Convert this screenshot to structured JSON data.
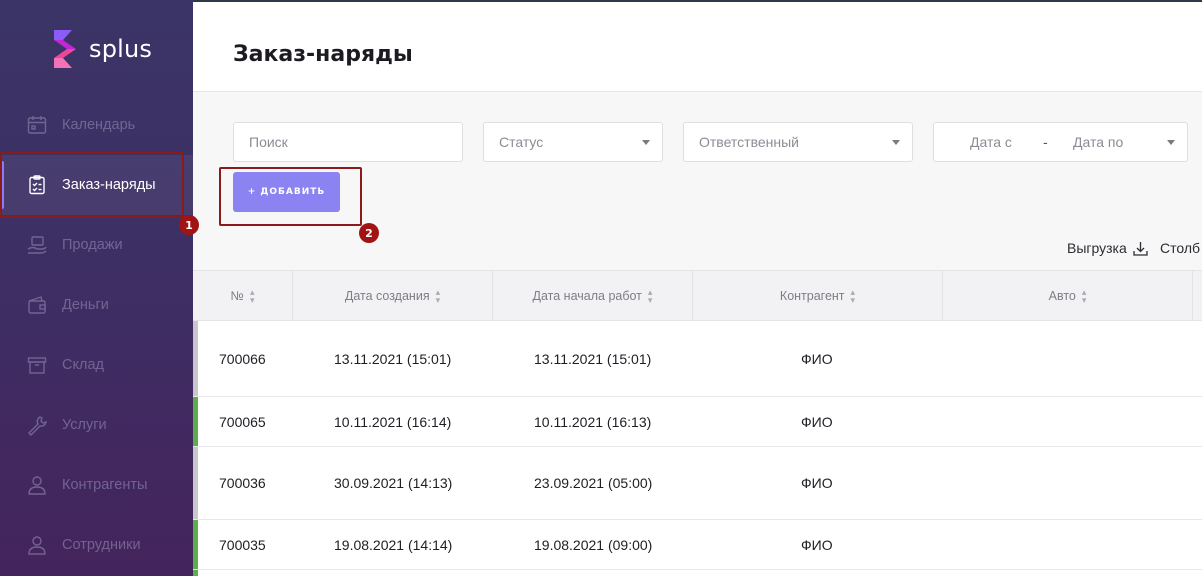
{
  "app": {
    "logo_text": "splus",
    "brand_color": "#8b83f2"
  },
  "sidebar": {
    "items": [
      {
        "label": "Календарь",
        "icon": "calendar-icon"
      },
      {
        "label": "Заказ-наряды",
        "icon": "clipboard-icon",
        "active": true
      },
      {
        "label": "Продажи",
        "icon": "hand-coin-icon"
      },
      {
        "label": "Деньги",
        "icon": "wallet-icon"
      },
      {
        "label": "Склад",
        "icon": "box-icon"
      },
      {
        "label": "Услуги",
        "icon": "wrench-icon"
      },
      {
        "label": "Контрагенты",
        "icon": "person-icon"
      },
      {
        "label": "Сотрудники",
        "icon": "person-icon"
      }
    ]
  },
  "annotations": {
    "badge1": "1",
    "badge2": "2"
  },
  "header": {
    "title": "Заказ-наряды"
  },
  "filters": {
    "search_placeholder": "Поиск",
    "status_placeholder": "Статус",
    "responsible_placeholder": "Ответственный",
    "date_from": "Дата с",
    "date_sep": "-",
    "date_to": "Дата по"
  },
  "actions": {
    "add_label": "+ ДОБАВИТЬ",
    "export_label": "Выгрузка",
    "columns_label": "Столб"
  },
  "table": {
    "headers": [
      "№",
      "Дата создания",
      "Дата начала работ",
      "Контрагент",
      "Авто"
    ],
    "rows": [
      {
        "number": "700066",
        "created": "13.11.2021 (15:01)",
        "start": "13.11.2021 (15:01)",
        "contractor": "ФИО",
        "marker": "#c8c8cc"
      },
      {
        "number": "700065",
        "created": "10.11.2021 (16:14)",
        "start": "10.11.2021 (16:13)",
        "contractor": "ФИО",
        "marker": "#5cae4a"
      },
      {
        "number": "700036",
        "created": "30.09.2021 (14:13)",
        "start": "23.09.2021 (05:00)",
        "contractor": "ФИО",
        "marker": "#c8c8cc"
      },
      {
        "number": "700035",
        "created": "19.08.2021 (14:14)",
        "start": "19.08.2021 (09:00)",
        "contractor": "ФИО",
        "marker": "#5cae4a"
      }
    ]
  }
}
